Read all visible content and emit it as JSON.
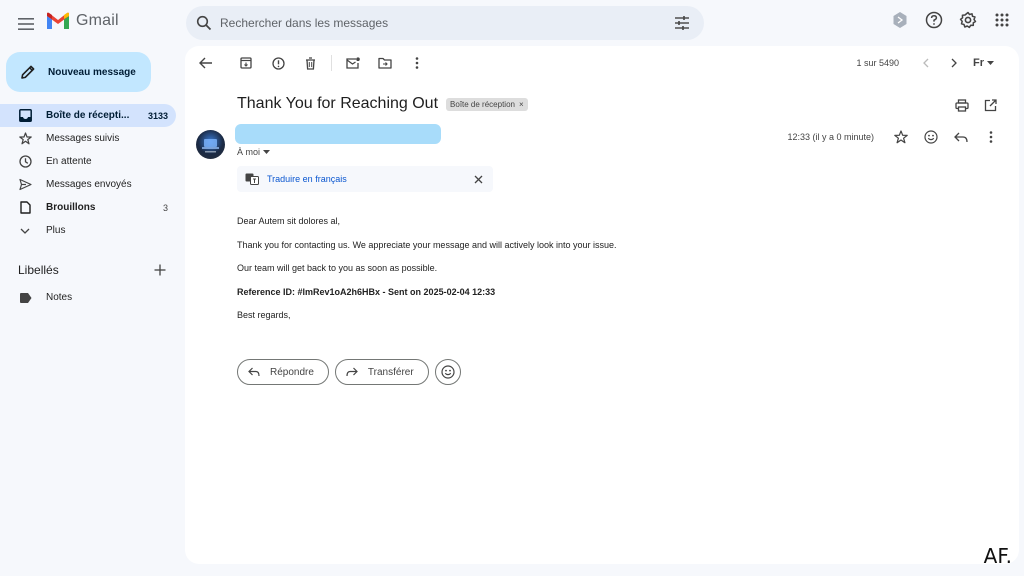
{
  "app": {
    "name": "Gmail"
  },
  "search": {
    "placeholder": "Rechercher dans les messages"
  },
  "sidebar": {
    "compose_label": "Nouveau message",
    "items": [
      {
        "label": "Boîte de récepti...",
        "count": "3133",
        "icon": "inbox-icon",
        "active": true
      },
      {
        "label": "Messages suivis",
        "count": "",
        "icon": "star-icon"
      },
      {
        "label": "En attente",
        "count": "",
        "icon": "clock-icon"
      },
      {
        "label": "Messages envoyés",
        "count": "",
        "icon": "send-icon"
      },
      {
        "label": "Brouillons",
        "count": "3",
        "icon": "draft-icon"
      },
      {
        "label": "Plus",
        "count": "",
        "icon": "chevron-down-icon"
      }
    ],
    "labels_title": "Libellés",
    "labels": [
      {
        "label": "Notes",
        "icon": "label-icon"
      }
    ]
  },
  "toolbar": {
    "pager_text": "1 sur 5490",
    "lang_label": "Fr"
  },
  "email": {
    "subject": "Thank You for Reaching Out",
    "tag": "Boîte de réception",
    "tag_close": "×",
    "to_label": "À moi",
    "time": "12:33 (il y a 0 minute)",
    "translate_label": "Traduire en français",
    "body": [
      "Dear Autem sit dolores al,",
      "Thank you for contacting us. We appreciate your message and will actively look into your issue.",
      "Our team will get back to you as soon as possible.",
      "Reference ID: #lmRev1oA2h6HBx - Sent on 2025-02-04 12:33",
      "Best regards,"
    ]
  },
  "actions": {
    "reply_label": "Répondre",
    "forward_label": "Transférer"
  },
  "watermark": "AF.",
  "colors": {
    "compose_bg": "#c2e7ff",
    "active_nav_bg": "#d3e3fd",
    "link": "#0b57d0",
    "redaction": "#a8dcfa"
  }
}
